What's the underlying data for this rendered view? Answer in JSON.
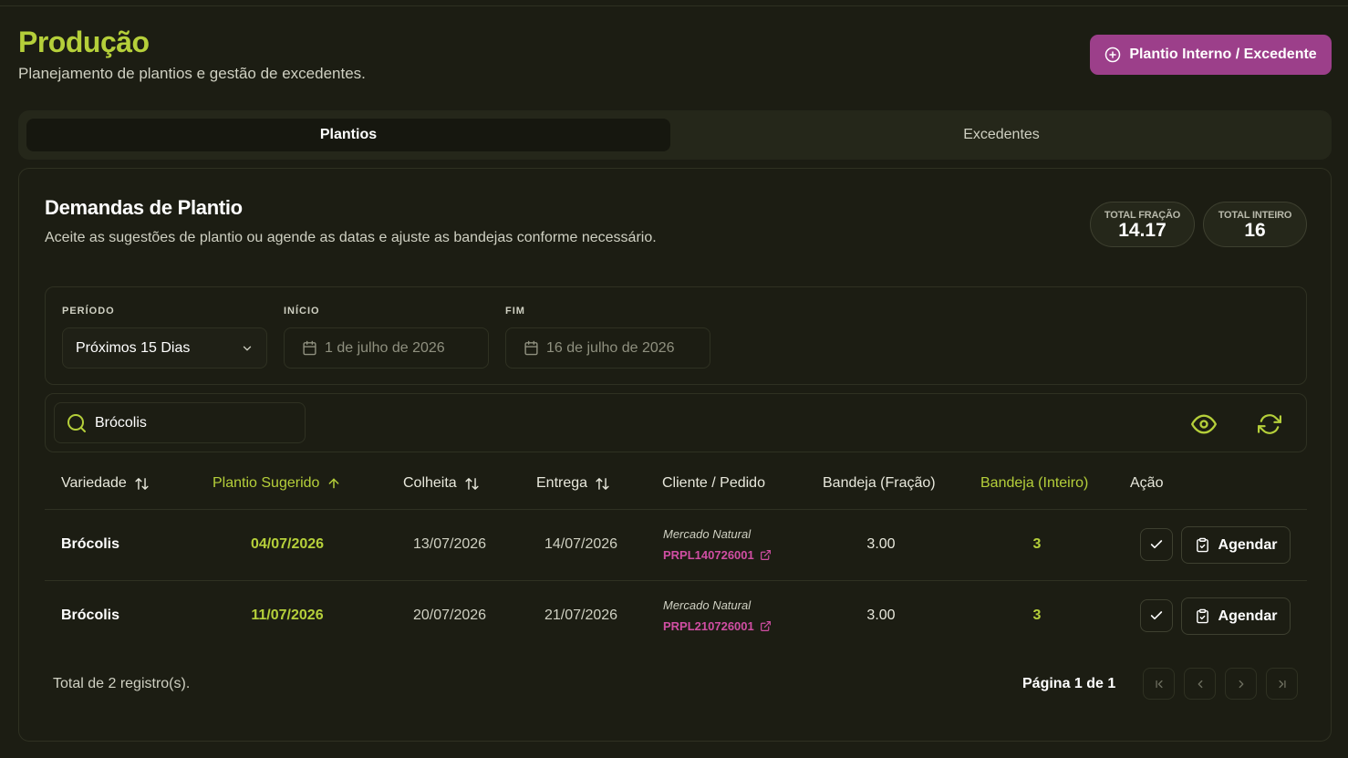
{
  "header": {
    "title": "Produção",
    "subtitle": "Planejamento de plantios e gestão de excedentes.",
    "primary_button": "Plantio Interno / Excedente"
  },
  "tabs": [
    {
      "label": "Plantios",
      "active": true
    },
    {
      "label": "Excedentes",
      "active": false
    }
  ],
  "card": {
    "title": "Demandas de Plantio",
    "subtitle": "Aceite as sugestões de plantio ou agende as datas e ajuste as bandejas conforme necessário."
  },
  "stats": {
    "fracao": {
      "label": "TOTAL FRAÇÃO",
      "value": "14.17"
    },
    "inteiro": {
      "label": "TOTAL INTEIRO",
      "value": "16"
    }
  },
  "filters": {
    "periodo": {
      "label": "PERÍODO",
      "value": "Próximos 15 Dias"
    },
    "inicio": {
      "label": "INÍCIO",
      "value": "1 de julho de 2026"
    },
    "fim": {
      "label": "FIM",
      "value": "16 de julho de 2026"
    }
  },
  "search": {
    "value": "Brócolis"
  },
  "table": {
    "headers": {
      "variedade": "Variedade",
      "plantio": "Plantio Sugerido",
      "colheita": "Colheita",
      "entrega": "Entrega",
      "cliente": "Cliente / Pedido",
      "fracao": "Bandeja (Fração)",
      "inteiro": "Bandeja (Inteiro)",
      "acao": "Ação"
    },
    "rows": [
      {
        "variedade": "Brócolis",
        "plantio": "04/07/2026",
        "colheita": "13/07/2026",
        "entrega": "14/07/2026",
        "cliente": "Mercado Natural",
        "pedido": "PRPL140726001",
        "fracao": "3.00",
        "inteiro": "3",
        "agendar": "Agendar"
      },
      {
        "variedade": "Brócolis",
        "plantio": "11/07/2026",
        "colheita": "20/07/2026",
        "entrega": "21/07/2026",
        "cliente": "Mercado Natural",
        "pedido": "PRPL210726001",
        "fracao": "3.00",
        "inteiro": "3",
        "agendar": "Agendar"
      }
    ]
  },
  "footer": {
    "total": "Total de 2 registro(s).",
    "page": "Página 1 de 1"
  },
  "colors": {
    "accent_green": "#b5cf3a",
    "accent_pink": "#9c3f8a",
    "link_pink": "#d04ea3",
    "background": "#1c1d13"
  }
}
